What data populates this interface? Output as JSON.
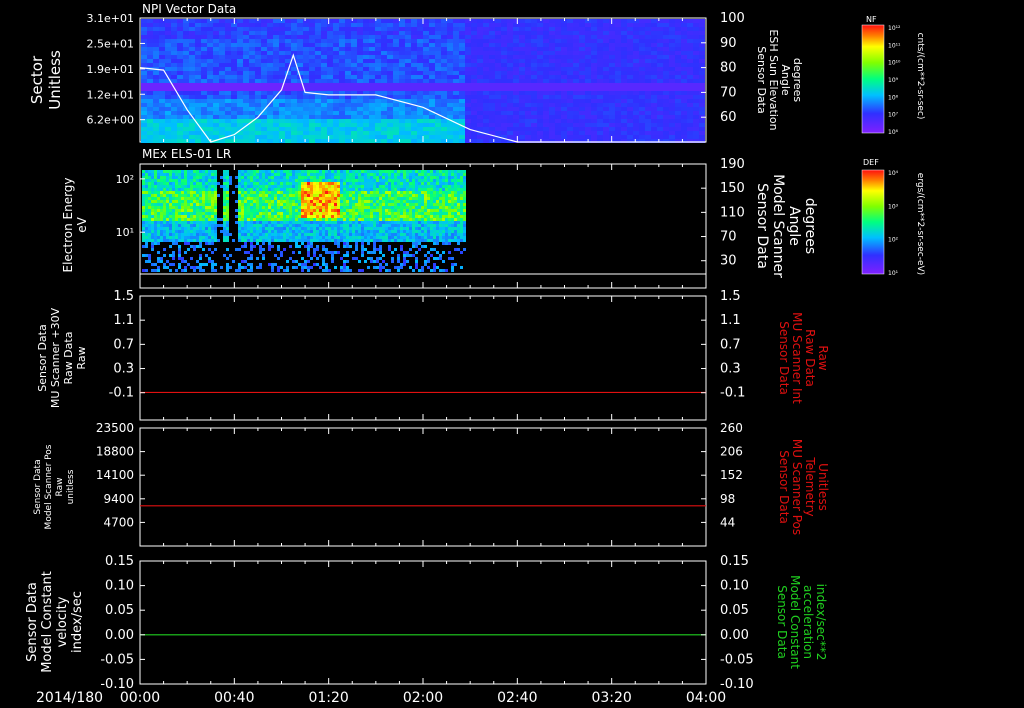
{
  "date_label": "2014/180",
  "time_ticks": [
    "00:00",
    "00:40",
    "01:20",
    "02:00",
    "02:40",
    "03:20",
    "04:00"
  ],
  "panel1": {
    "title": "NPI Vector Data",
    "ylabel_left": [
      "Sector",
      "Unitless"
    ],
    "yticks_left": [
      "3.1e+01",
      "2.5e+01",
      "1.9e+01",
      "1.2e+01",
      "6.2e+00"
    ],
    "ylabel_right": [
      "Sensor Data",
      "ESH Sun Elevation",
      "Angle",
      "degrees"
    ],
    "yticks_right": [
      "100",
      "90",
      "80",
      "70",
      "60"
    ],
    "colorbar": {
      "title": "NF",
      "ticks": [
        "10¹²",
        "10¹¹",
        "10¹⁰",
        "10⁹",
        "10⁸",
        "10⁷",
        "10⁶"
      ],
      "unit": "cnts/(cm**2-sr-sec)"
    }
  },
  "panel2": {
    "title": "MEx ELS-01 LR",
    "ylabel_left": [
      "Electron Energy",
      "eV"
    ],
    "yticks_left": [
      "10²",
      "10¹"
    ],
    "ylabel_right": [
      "Sensor Data",
      "Model Scanner",
      "Angle",
      "degrees"
    ],
    "yticks_right": [
      "190",
      "150",
      "110",
      "70",
      "30"
    ],
    "colorbar": {
      "title": "DEF",
      "ticks": [
        "10⁴",
        "10³",
        "10²",
        "10¹"
      ],
      "unit": "ergs/(cm**2-sr-sec-eV)"
    }
  },
  "panel3": {
    "ylabel_left": [
      "Sensor Data",
      "MU Scanner +30V",
      "Raw Data",
      "Raw"
    ],
    "yticks_left": [
      "1.5",
      "1.1",
      "0.7",
      "0.3",
      "-0.1"
    ],
    "ylabel_right": [
      "Sensor Data",
      "MU Scanner Int",
      "Raw Data",
      "Raw"
    ],
    "yticks_right": [
      "1.5",
      "1.1",
      "0.7",
      "0.3",
      "-0.1"
    ]
  },
  "panel4": {
    "ylabel_left": [
      "Sensor Data",
      "Model Scanner Pos",
      "Raw",
      "unitless"
    ],
    "yticks_left": [
      "23500",
      "18800",
      "14100",
      "9400",
      "4700"
    ],
    "ylabel_right": [
      "Sensor Data",
      "MU Scanner Pos",
      "Telemetry",
      "Unitless"
    ],
    "yticks_right": [
      "260",
      "206",
      "152",
      "98",
      "44"
    ]
  },
  "panel5": {
    "ylabel_left": [
      "Sensor Data",
      "Model Constant",
      "velocity",
      "index/sec"
    ],
    "yticks_left": [
      "0.15",
      "0.10",
      "0.05",
      "0.00",
      "-0.05",
      "-0.10"
    ],
    "ylabel_right": [
      "Sensor Data",
      "Model Constant",
      "acceleration",
      "index/sec**2"
    ],
    "yticks_right": [
      "0.15",
      "0.10",
      "0.05",
      "0.00",
      "-0.05",
      "-0.10"
    ]
  },
  "colors": {
    "red": "#e01010",
    "green": "#20d020",
    "white": "#ffffff"
  },
  "chart_data": [
    {
      "type": "heatmap",
      "title": "NPI Vector Data",
      "ylabel": "Sector Unitless",
      "xrange": [
        "00:00",
        "04:00"
      ],
      "yrange": [
        0,
        31
      ],
      "line_series": {
        "name": "ESH Sun Elevation Angle",
        "x_minutes": [
          0,
          10,
          20,
          30,
          40,
          50,
          60,
          65,
          70,
          80,
          100,
          120,
          140,
          160,
          180,
          200,
          240
        ],
        "y_degrees": [
          80,
          79,
          63,
          50,
          53,
          60,
          71,
          85,
          70,
          69,
          69,
          64,
          55,
          50,
          50,
          50,
          50
        ]
      },
      "right_yrange": [
        50,
        100
      ],
      "empty_after_minutes": 137
    },
    {
      "type": "heatmap",
      "title": "MEx ELS-01 LR",
      "ylabel": "Electron Energy eV",
      "xrange": [
        "00:00",
        "04:00"
      ],
      "data_until_minutes": 137,
      "right_series": {
        "name": "Model Scanner Angle",
        "value_degrees": 23
      },
      "right_yrange": [
        10,
        190
      ]
    },
    {
      "type": "line",
      "ylabel": "MU Scanner +30V Raw Data Raw",
      "ylim": [
        -0.3,
        1.5
      ],
      "series": [
        {
          "name": "MU Scanner Int Raw Data",
          "color": "#e01010",
          "x_minutes": [
            0,
            240
          ],
          "values": [
            0.1,
            0.1
          ]
        }
      ]
    },
    {
      "type": "line",
      "ylabel": "Model Scanner Pos Raw unitless",
      "ylim": [
        0,
        23500
      ],
      "series": [
        {
          "name": "MU Scanner Pos Telemetry",
          "color": "#e01010",
          "x_minutes": [
            0,
            240
          ],
          "values": [
            8000,
            8000
          ]
        }
      ]
    },
    {
      "type": "line",
      "ylabel": "Model Constant velocity index/sec",
      "ylim": [
        -0.1,
        0.15
      ],
      "series": [
        {
          "name": "Model Constant velocity",
          "color": "#20d020",
          "x_minutes": [
            0,
            240
          ],
          "values": [
            0.0,
            0.0
          ]
        }
      ]
    }
  ]
}
